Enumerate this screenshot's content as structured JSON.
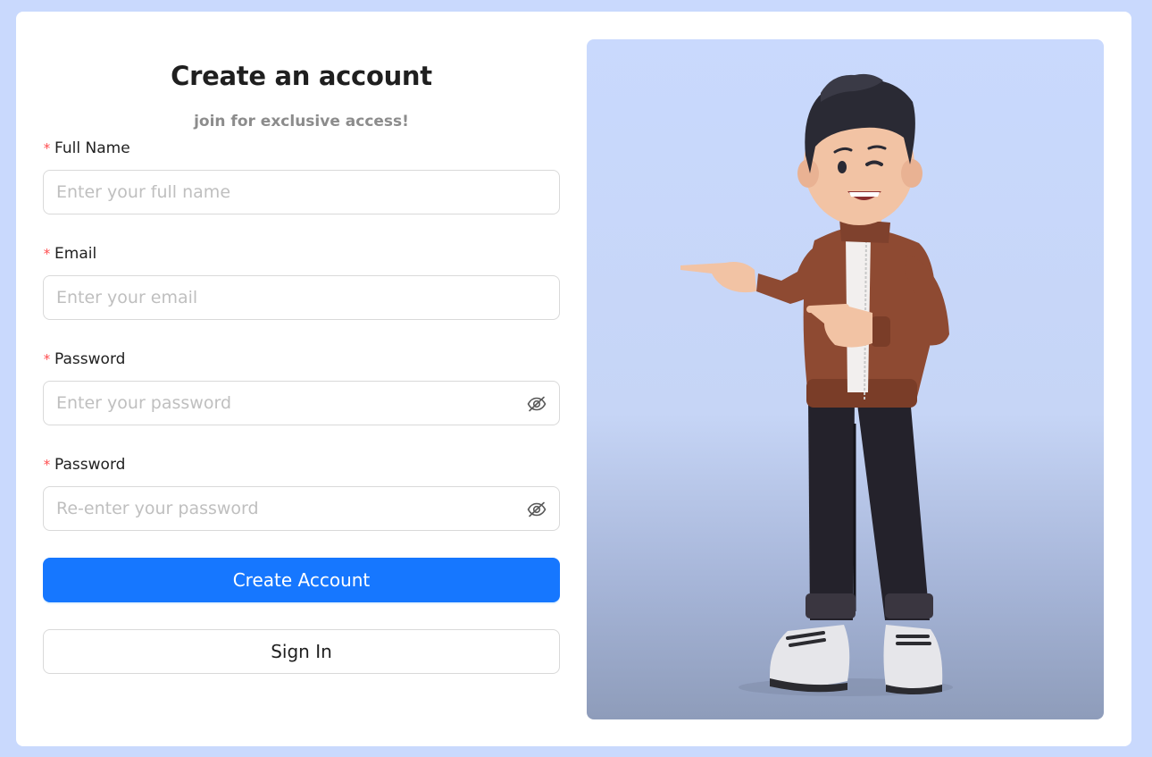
{
  "header": {
    "title": "Create an account",
    "subtitle": "join for exclusive access!"
  },
  "form": {
    "required_marker": "*",
    "fields": [
      {
        "label": "Full Name",
        "placeholder": "Enter your full name",
        "value": ""
      },
      {
        "label": "Email",
        "placeholder": "Enter your email",
        "value": ""
      },
      {
        "label": "Password",
        "placeholder": "Enter your password",
        "value": ""
      },
      {
        "label": "Password",
        "placeholder": "Re-enter your password",
        "value": ""
      }
    ],
    "create_button_label": "Create Account",
    "signin_button_label": "Sign In"
  },
  "icons": {
    "password_toggle": "eye-invisible-icon"
  },
  "illustration": {
    "subject": "3d-character-pointing-left"
  },
  "colors": {
    "page_background": "#c9d9fd",
    "primary": "#1677ff",
    "required": "#ff4d4f",
    "subtitle": "#8c8c8c"
  }
}
